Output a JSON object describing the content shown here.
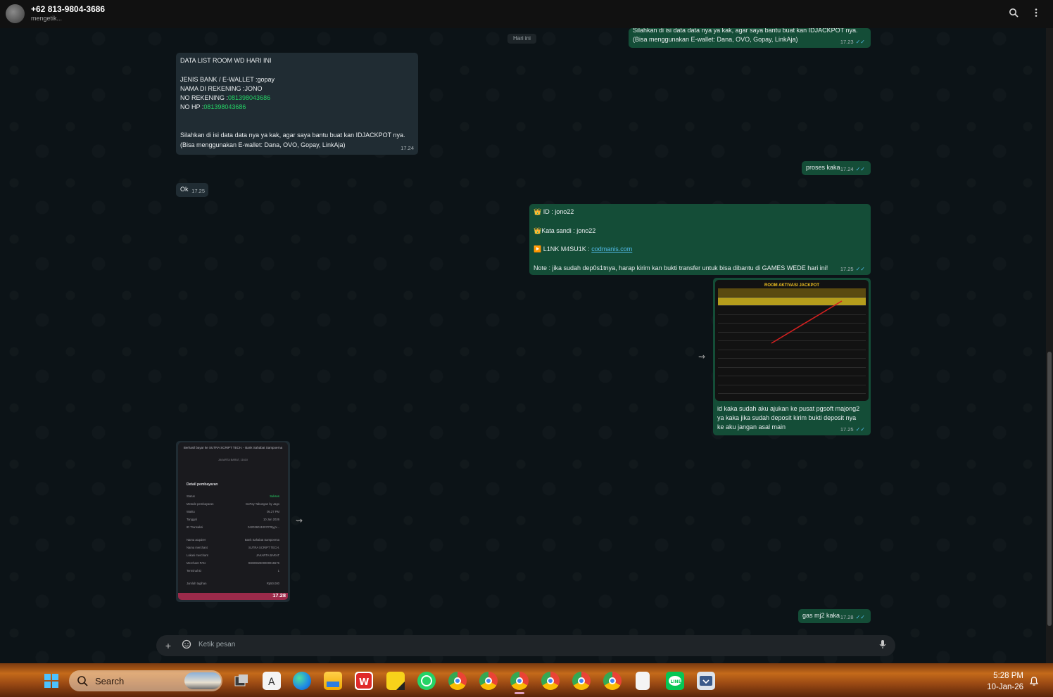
{
  "header": {
    "contact_name": "+62 813-9804-3686",
    "contact_status": "mengetik...",
    "icons": [
      "search-icon",
      "more-vertical-icon"
    ]
  },
  "date_chip": "Hari ini",
  "messages": {
    "m1": {
      "direction": "outgoing",
      "line1": "Silahkan di isi data data nya ya kak, agar saya bantu buat kan IDJACKPOT nya.",
      "line2": "(Bisa menggunakan E-wallet: Dana, OVO, Gopay, LinkAja)",
      "time": "17.23",
      "ticks": "✓✓"
    },
    "m2": {
      "direction": "incoming",
      "title": "DATA LIST ROOM WD HARI INI",
      "bank_line": "JENIS BANK / E-WALLET :gopay",
      "name_line": "NAMA DI REKENING :JONO",
      "norek_label": "NO REKENING :",
      "norek_value": "081398043686",
      "nohp_label": "NO HP :",
      "nohp_value": "081398043686",
      "line1": "Silahkan di isi data data nya ya kak, agar saya bantu buat kan IDJACKPOT nya.",
      "line2": "(Bisa menggunakan E-wallet: Dana, OVO, Gopay, LinkAja)",
      "time": "17.24"
    },
    "m3": {
      "direction": "outgoing",
      "text": "proses kaka",
      "time": "17.24",
      "ticks": "✓✓"
    },
    "m4": {
      "direction": "incoming",
      "text": "Ok",
      "time": "17.25"
    },
    "m5": {
      "direction": "outgoing",
      "id_line": "👑 ID :  jono22",
      "pass_line": "👑Kata sandi : jono22",
      "link_label": "▶️ L1NK M4SU1K : ",
      "link_value": "codmanis.com",
      "note": "Note : jika sudah dep0s1tnya, harap kirim kan bukti transfer untuk bisa dibantu di GAMES WEDE hari ini!",
      "time": "17.25",
      "ticks": "✓✓"
    },
    "m6": {
      "direction": "outgoing",
      "image_title": "ROOM AKTIVASI JACKPOT",
      "caption1": "id kaka sudah aku ajukan ke pusat pgsoft majong2",
      "caption2": "ya kaka jika sudah deposit kirim bukti deposit nya",
      "caption3": "ke aku jangan asal main",
      "time": "17.25",
      "ticks": "✓✓"
    },
    "m7": {
      "direction": "incoming",
      "receipt_top": "Berhasil bayar ke SUTRA SCRIPT TECH. - Bank Sahabat Sampoerna",
      "receipt_loc": "JAKARTA BARAT, 11610",
      "receipt_heading": "Detail pembayaran",
      "rows": [
        {
          "k": "Status",
          "v": "Sukses"
        },
        {
          "k": "Metode pembayaran",
          "v": "GoPay Tabungan by Jago"
        },
        {
          "k": "Waktu",
          "v": "05.27 PM"
        },
        {
          "k": "Tanggal",
          "v": "10 Jan 2026"
        },
        {
          "k": "ID Transaksi",
          "v": "04202601100727Byyx..."
        },
        {
          "k": "Nama acquirer",
          "v": "Bank Sahabat Sampoerna"
        },
        {
          "k": "Nama merchant",
          "v": "SUTRA SCRIPT TECH."
        },
        {
          "k": "Lokasi merchant",
          "v": "JAKARTA BARAT"
        },
        {
          "k": "Merchant PAN",
          "v": "9360062300000015576"
        },
        {
          "k": "Terminal ID",
          "v": "1"
        },
        {
          "k": "Jumlah tagihan",
          "v": "Rp50.000"
        }
      ],
      "time": "17.28"
    },
    "m8": {
      "direction": "outgoing",
      "text": "gas mj2 kaka",
      "time": "17.28",
      "ticks": "✓✓"
    }
  },
  "composer": {
    "placeholder": "Ketik pesan",
    "icons": [
      "plus-icon",
      "sticker-icon",
      "microphone-icon"
    ]
  },
  "taskbar": {
    "search_label": "Search",
    "clock_time": "5:28 PM",
    "clock_date": "10-Jan-26",
    "apps": [
      "windows-start-icon",
      "task-view-icon",
      "notepad-icon",
      "edge-icon",
      "file-explorer-icon",
      "wps-icon",
      "sticky-notes-icon",
      "whatsapp-icon",
      "chrome-icon",
      "chrome-icon",
      "chrome-icon",
      "chrome-icon",
      "chrome-icon",
      "chrome-icon",
      "file-icon",
      "line-icon",
      "app-icon"
    ],
    "colors": {
      "whatsapp": "#25d366",
      "line": "#06c755",
      "edge": "#1e88e5"
    }
  },
  "colors": {
    "outgoing_bubble": "#144d37",
    "incoming_bubble": "#202c33",
    "link_green": "#25d366",
    "tick_blue": "#53bdeb"
  }
}
